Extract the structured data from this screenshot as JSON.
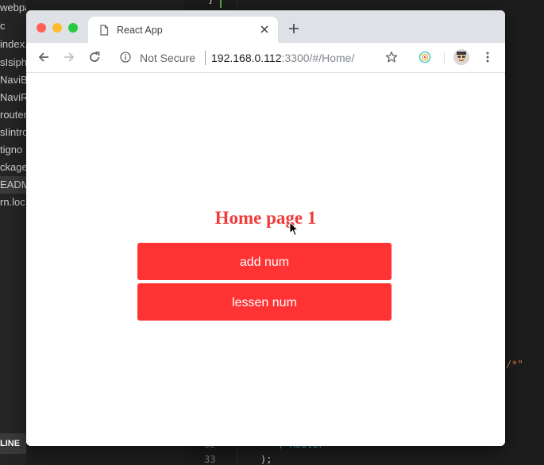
{
  "background_editor": {
    "file_list": [
      "webpack.tip.js",
      "c",
      "index.",
      "sIsipho",
      "NaviB",
      "NaviR",
      "router",
      "sIintro",
      "tigno",
      "ckage",
      "EADM",
      "rn.loc"
    ],
    "footer_label": "LINE",
    "code_fragments": {
      "top_brace": "}",
      "comment_fragment": "/*\"",
      "router_fragment": "; Router",
      "line_32": "32",
      "line_33": "33",
      "closing": ");"
    }
  },
  "browser": {
    "tab": {
      "title": "React App",
      "doc_icon": "document-icon",
      "close_icon": "close-icon"
    },
    "new_tab_icon": "plus-icon",
    "toolbar": {
      "back_icon": "back-arrow-icon",
      "forward_icon": "forward-arrow-icon",
      "reload_icon": "reload-icon",
      "info_icon": "info-icon",
      "security_label": "Not Secure",
      "url_host": "192.168.0.112",
      "url_rest": ":3300/#/Home/",
      "bookmark_icon": "star-icon",
      "extension_icon": "extension-icon",
      "menu_icon": "kebab-menu-icon"
    }
  },
  "page": {
    "heading": "Home page 1",
    "buttons": {
      "add_label": "add num",
      "lessen_label": "lessen num"
    }
  },
  "colors": {
    "accent_red": "#ff3333",
    "heading_red": "#ef3b3b",
    "chrome_gray": "#dee1e6"
  }
}
